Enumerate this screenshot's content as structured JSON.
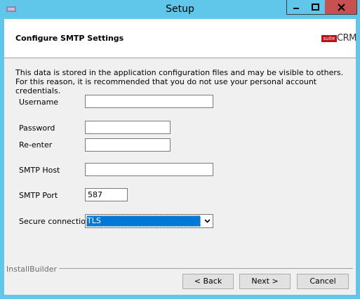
{
  "window": {
    "title": "Setup",
    "controls": [
      "minimize-icon",
      "maximize-icon",
      "close-icon"
    ],
    "frame_color": "#60c6ea",
    "close_color": "#c75050"
  },
  "header": {
    "title": "Configure SMTP Settings",
    "logo": {
      "suite": "suite",
      "crm": "CRM"
    }
  },
  "description": "This data is stored in the application configuration files and may be visible to others. For this reason, it is recommended that you do not use your personal account credentials.",
  "form": {
    "username": {
      "label": "Username",
      "value": ""
    },
    "password": {
      "label": "Password",
      "value": ""
    },
    "reenter": {
      "label": "Re-enter",
      "value": ""
    },
    "smtp_host": {
      "label": "SMTP Host",
      "value": ""
    },
    "smtp_port": {
      "label": "SMTP Port",
      "value": "587"
    },
    "secure_connection": {
      "label": "Secure connection",
      "selected": "TLS"
    }
  },
  "footer": {
    "brand": "InstallBuilder",
    "back_label": "< Back",
    "next_label": "Next >",
    "cancel_label": "Cancel"
  },
  "colors": {
    "selection": "#0078d7",
    "logo_red": "#b5121b"
  }
}
